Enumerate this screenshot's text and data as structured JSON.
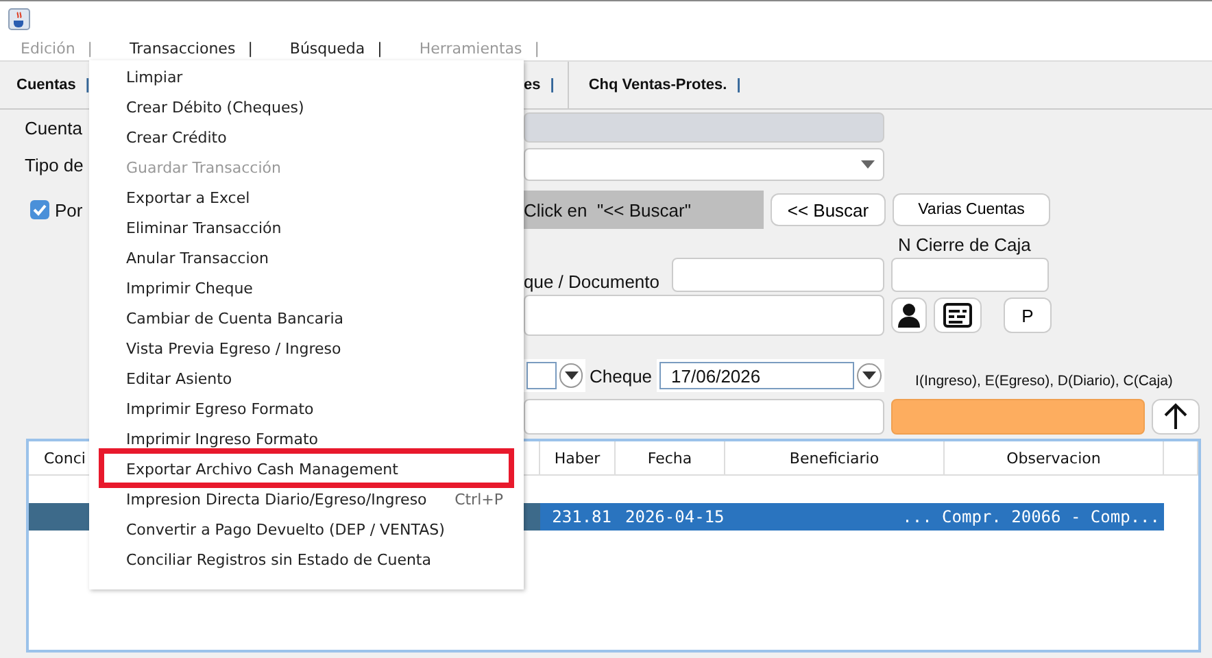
{
  "menubar": [
    {
      "label": "Edición",
      "divider": "|",
      "disabled": true
    },
    {
      "label": "Transacciones",
      "divider": "|",
      "disabled": false
    },
    {
      "label": "Búsqueda",
      "divider": "|",
      "disabled": false
    },
    {
      "label": "Herramientas",
      "divider": "|",
      "disabled": true
    }
  ],
  "tabs": [
    {
      "label": "Cuentas",
      "divider": "|"
    },
    {
      "label": "es",
      "divider": "|"
    },
    {
      "label": "Chq Ventas-Protes.",
      "divider": "|"
    }
  ],
  "form": {
    "cuenta_label": "Cuenta",
    "tipo_label": "Tipo de",
    "por_checkbox": {
      "label": "Por",
      "checked": true
    },
    "hint": "Click en  \"<< Buscar\"",
    "buscar_button": "<< Buscar",
    "varias_button": "Varias Cuentas",
    "cierre_label": "N Cierre de Caja",
    "documento_label": "que / Documento",
    "p_button": "P",
    "cheque_label": "Cheque",
    "cheque_date": "17/06/2026",
    "legend": "I(Ingreso), E(Egreso), D(Diario), C(Caja)"
  },
  "table": {
    "columns": [
      "Conci",
      "Haber",
      "Fecha",
      "Beneficiario",
      "Observacion"
    ],
    "rows": [
      {
        "selected": true,
        "haber": "231.81",
        "fecha": "2026-04-15",
        "observacion": "... Compr. 20066 - Comp..."
      }
    ]
  },
  "menu": {
    "items": [
      {
        "label": "Limpiar",
        "disabled": false,
        "annotated": false
      },
      {
        "label": "Crear Débito (Cheques)",
        "disabled": false,
        "annotated": false
      },
      {
        "label": "Crear Crédito",
        "disabled": false,
        "annotated": false
      },
      {
        "label": "Guardar Transacción",
        "disabled": true,
        "annotated": false
      },
      {
        "label": "Exportar a Excel",
        "disabled": false,
        "annotated": false
      },
      {
        "label": "Eliminar Transacción",
        "disabled": false,
        "annotated": false
      },
      {
        "label": "Anular Transaccion",
        "disabled": false,
        "annotated": false
      },
      {
        "label": "Imprimir Cheque",
        "disabled": false,
        "annotated": false
      },
      {
        "label": "Cambiar de Cuenta Bancaria",
        "disabled": false,
        "annotated": false
      },
      {
        "label": "Vista Previa Egreso / Ingreso",
        "disabled": false,
        "annotated": false
      },
      {
        "label": "Editar Asiento",
        "disabled": false,
        "annotated": false
      },
      {
        "label": "Imprimir Egreso Formato",
        "disabled": false,
        "annotated": false
      },
      {
        "label": "Imprimir Ingreso Formato",
        "disabled": false,
        "annotated": false
      },
      {
        "label": "Exportar Archivo Cash Management",
        "disabled": false,
        "annotated": true
      },
      {
        "label": "Impresion Directa Diario/Egreso/Ingreso",
        "shortcut": "Ctrl+P",
        "disabled": false,
        "annotated": false
      },
      {
        "label": "Convertir a Pago Devuelto (DEP / VENTAS)",
        "disabled": false,
        "annotated": false
      },
      {
        "label": "Conciliar Registros sin Estado de Cuenta",
        "disabled": false,
        "annotated": false
      }
    ]
  }
}
